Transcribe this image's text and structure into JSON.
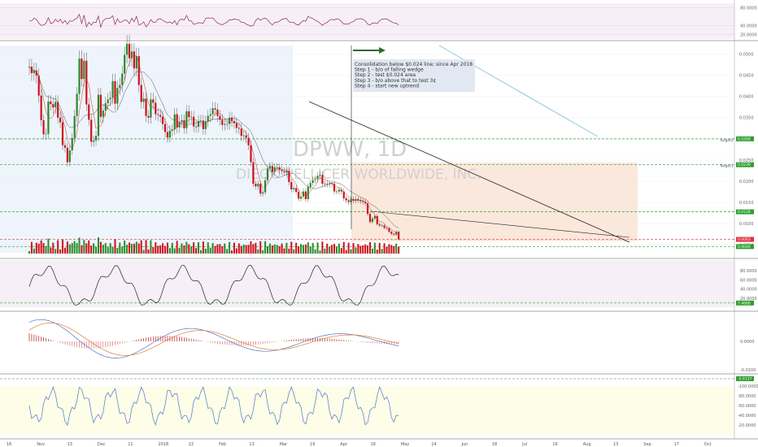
{
  "chart_data": {
    "type": "candlestick",
    "watermark": {
      "symbol": "DPWW, 1D",
      "company": "DIEGO PELLICER WORLDWIDE, INC."
    },
    "annotation_lines": [
      "Consolidation below $0.024 line; since Apr 2018",
      "Step 1 - b/o of falling wedge",
      "Step 2 - test $0.024 area",
      "Step 3 - b/o above that to test 3¢",
      "Step 4 - start new uptrend"
    ],
    "x_dates": [
      "16",
      "Nov",
      "13",
      "Dec",
      "11",
      "2018",
      "22",
      "Feb",
      "13",
      "Mar",
      "19",
      "Apr",
      "16",
      "May",
      "14",
      "Jun",
      "18",
      "Jul",
      "16",
      "Aug",
      "13",
      "Sep",
      "17",
      "Oct"
    ],
    "price_axis": [
      "0.0500",
      "0.0450",
      "0.0400",
      "0.0350",
      "0.0300",
      "0.0250",
      "0.0200",
      "0.0150",
      "0.0100",
      "0.0050"
    ],
    "price_range": [
      0.002,
      0.052
    ],
    "levels": [
      {
        "name": "Target2",
        "value": 0.03,
        "tag": "0.0300",
        "color": "#2e9e2e"
      },
      {
        "name": "Target1",
        "value": 0.0239,
        "tag": "0.0239",
        "color": "#2e9e2e"
      },
      {
        "name": "",
        "value": 0.0128,
        "tag": "0.0128",
        "color": "#2e9e2e"
      },
      {
        "name": "",
        "value": 0.0063,
        "tag": "0.0063",
        "color": "#e0303b"
      },
      {
        "name": "",
        "value": 0.0046,
        "tag": "0.0046",
        "color": "#2e9e2e"
      }
    ],
    "rsi_axis": [
      "80.0000",
      "40.0000",
      "20.0000"
    ],
    "stoch_axis": [
      "80.0000",
      "60.0000",
      "40.0000",
      "20.0000"
    ],
    "stoch_tag": "7.4668",
    "macd_axis": [
      "0.0000",
      "-0.0100"
    ],
    "willr_axis": [
      "-20.0000",
      "-40.0000",
      "-60.0000",
      "-80.0000",
      "-100.0000"
    ],
    "willr_tag": "-5.0137",
    "closes": [
      0.047,
      0.0455,
      0.0461,
      0.0449,
      0.0402,
      0.0344,
      0.0311,
      0.0312,
      0.0388,
      0.0382,
      0.0374,
      0.0387,
      0.035,
      0.0339,
      0.0285,
      0.0279,
      0.0245,
      0.0273,
      0.0302,
      0.0354,
      0.0406,
      0.0489,
      0.0441,
      0.0484,
      0.0381,
      0.0345,
      0.0293,
      0.0296,
      0.0307,
      0.0404,
      0.0352,
      0.0367,
      0.0384,
      0.0393,
      0.0397,
      0.0436,
      0.0383,
      0.042,
      0.0427,
      0.0454,
      0.0498,
      0.0524,
      0.049,
      0.0506,
      0.0466,
      0.0495,
      0.0427,
      0.0387,
      0.0395,
      0.0354,
      0.035,
      0.0393,
      0.0385,
      0.0358,
      0.0356,
      0.0352,
      0.0335,
      0.0316,
      0.0303,
      0.0319,
      0.0322,
      0.0358,
      0.0327,
      0.034,
      0.0344,
      0.0325,
      0.0365,
      0.0351,
      0.0352,
      0.0329,
      0.0328,
      0.0342,
      0.0343,
      0.0323,
      0.0341,
      0.0354,
      0.0358,
      0.0372,
      0.0369,
      0.0354,
      0.0345,
      0.0333,
      0.0335,
      0.0335,
      0.035,
      0.0342,
      0.0337,
      0.0326,
      0.0324,
      0.0307,
      0.0308,
      0.0302,
      0.0285,
      0.0245,
      0.0194,
      0.0188,
      0.0194,
      0.0171,
      0.0174,
      0.0202,
      0.023,
      0.0236,
      0.0222,
      0.0233,
      0.0233,
      0.0227,
      0.0224,
      0.0221,
      0.0225,
      0.0198,
      0.0181,
      0.0184,
      0.0175,
      0.0159,
      0.0164,
      0.0176,
      0.0158,
      0.0187,
      0.0196,
      0.0203,
      0.0205,
      0.0213,
      0.0215,
      0.0194,
      0.0194,
      0.0193,
      0.0195,
      0.0194,
      0.0176,
      0.0176,
      0.018,
      0.0176,
      0.016,
      0.0155,
      0.0151,
      0.0158,
      0.0154,
      0.0158,
      0.0155,
      0.0153,
      0.0151,
      0.0148,
      0.0123,
      0.0104,
      0.0112,
      0.0118,
      0.0099,
      0.0096,
      0.0096,
      0.009,
      0.0089,
      0.0081,
      0.0076,
      0.0074,
      0.0081,
      0.0063
    ]
  }
}
